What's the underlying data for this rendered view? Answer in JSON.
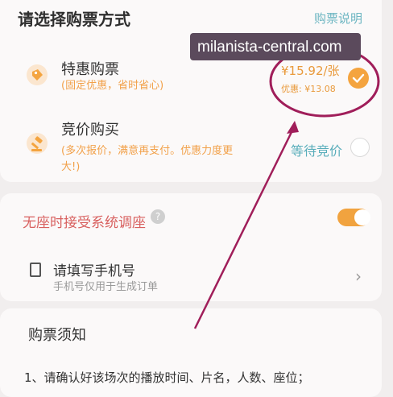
{
  "header": {
    "title": "请选择购票方式",
    "help_link": "购票说明"
  },
  "watermark": {
    "text": "milanista-central.com"
  },
  "options": [
    {
      "title": "特惠购票",
      "subtitle": "(固定优惠，省时省心)",
      "price": "¥15.92/张",
      "saving": "优惠: ¥13.08",
      "selected": true,
      "icon": "tag-icon"
    },
    {
      "title": "竞价购买",
      "subtitle_line1": "(多次报价，满意再支付。优惠力度更",
      "subtitle_line2": "大!)",
      "status": "等待竞价",
      "selected": false,
      "icon": "gavel-icon"
    }
  ],
  "settings": {
    "no_seat_label": "无座时接受系统调座",
    "help_mark": "?",
    "toggle_on": true,
    "phone_title": "请填写手机号",
    "phone_subtitle": "手机号仅用于生成订单"
  },
  "notice": {
    "title": "购票须知",
    "line1": "1、请确认好该场次的播放时间、片名，人数、座位；"
  },
  "colors": {
    "accent_orange": "#f4a43f",
    "link_teal": "#6db6c2",
    "annotation": "#a01e5a",
    "warning_red": "#d8605f"
  }
}
